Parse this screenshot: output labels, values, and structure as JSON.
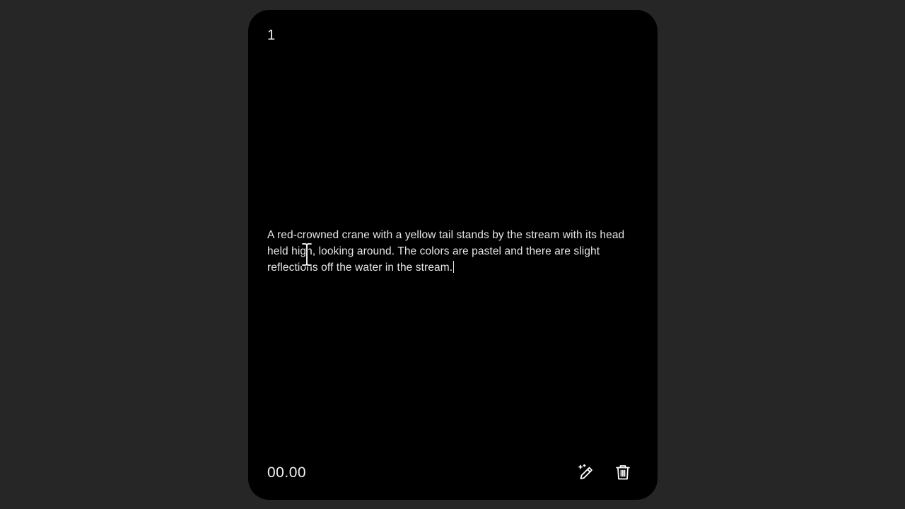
{
  "card": {
    "index": "1",
    "prompt_text": "A red-crowned crane with a yellow tail stands by the stream with its head held high, looking around. The colors are pastel and there are slight reflections off the water in the stream.",
    "duration": "00.00"
  },
  "actions": [
    {
      "name": "magic-edit",
      "icon": "wand-pencil-icon"
    },
    {
      "name": "delete",
      "icon": "trash-icon"
    }
  ],
  "colors": {
    "background": "#262626",
    "card": "#000000",
    "text": "#e6e6e6"
  }
}
